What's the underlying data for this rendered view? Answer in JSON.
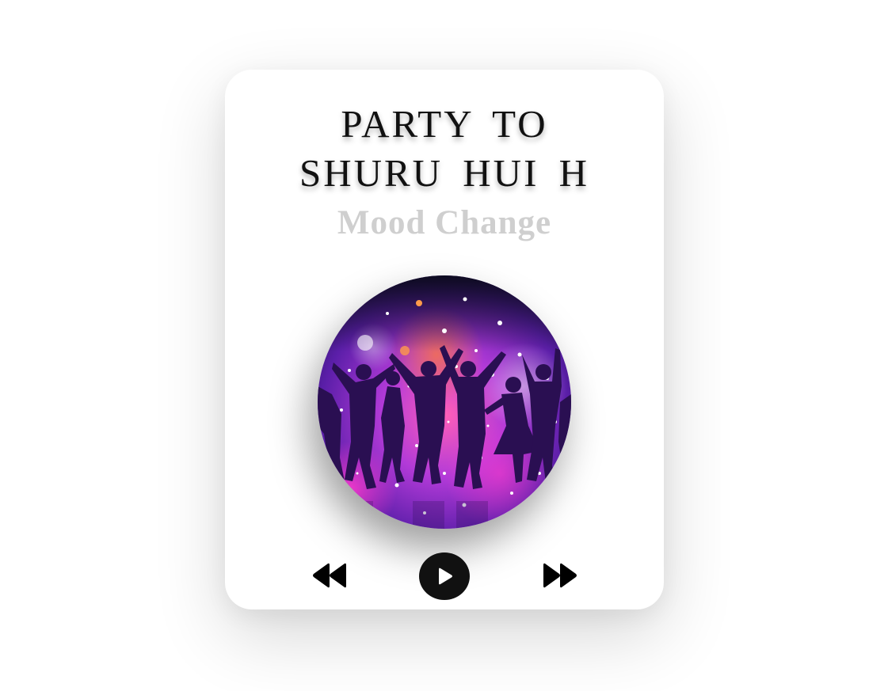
{
  "player": {
    "title_lines": [
      "PARTY TO",
      "SHURU HUI H"
    ],
    "subtitle": "Mood Change",
    "album_art": "party-dancers-silhouette-image"
  },
  "controls": {
    "previous": "rewind-icon",
    "play": "play-icon",
    "next": "fast-forward-icon"
  },
  "colors": {
    "title": "#111111",
    "subtitle": "#cfcfcf",
    "play_button": "#111111",
    "card": "#ffffff"
  }
}
